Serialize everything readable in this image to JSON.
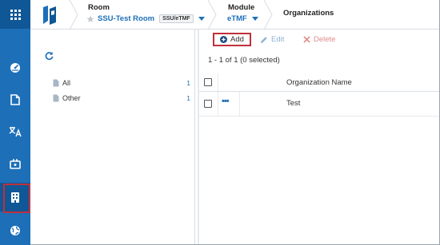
{
  "header": {
    "room_label": "Room",
    "room_name": "SSU-Test Room",
    "room_badge": "SSU/eTMF",
    "module_label": "Module",
    "module_name": "eTMF",
    "page_title": "Organizations"
  },
  "sidebar": {
    "items": [
      {
        "name": "dashboard-icon"
      },
      {
        "name": "document-icon"
      },
      {
        "name": "translate-icon"
      },
      {
        "name": "plugin-icon"
      },
      {
        "name": "building-icon",
        "active": true
      },
      {
        "name": "globe-icon"
      }
    ]
  },
  "tree": {
    "items": [
      {
        "label": "All",
        "count": "1"
      },
      {
        "label": "Other",
        "count": "1"
      }
    ]
  },
  "toolbar": {
    "add_label": "Add",
    "edit_label": "Edit",
    "delete_label": "Delete"
  },
  "grid": {
    "summary": "1 - 1 of 1 (0 selected)",
    "column_name": "Organization Name",
    "rows": [
      {
        "name": "Test",
        "actions": "•••"
      }
    ]
  },
  "colors": {
    "brand": "#1d6fb8",
    "rail_dark": "#0f5797",
    "highlight": "#c0303a"
  }
}
